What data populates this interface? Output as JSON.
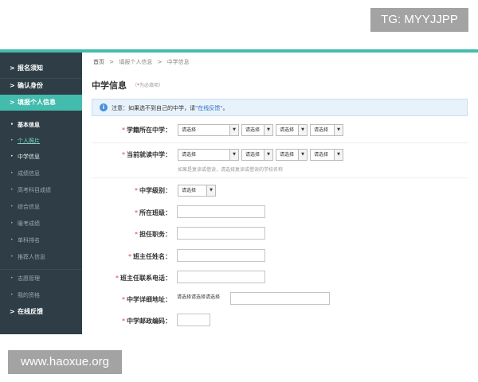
{
  "watermarks": {
    "top_right": "TG: MYYJJPP",
    "bottom_left": "www.haoxue.org"
  },
  "colors": {
    "accent": "#43bcae",
    "sidebar_bg": "#2f3e46",
    "required_star": "#e2403a",
    "link": "#2a6fc0"
  },
  "sidebar": {
    "items": [
      {
        "label": "报名须知",
        "icon": "chevron-right-icon"
      },
      {
        "label": "确认身份",
        "icon": "chevron-right-icon"
      },
      {
        "label": "填报个人信息",
        "icon": "chevron-right-icon",
        "active": true
      }
    ],
    "subitems": [
      {
        "label": "基本信息",
        "kind": "head"
      },
      {
        "label": "个人照片",
        "kind": "current"
      },
      {
        "label": "中学信息",
        "kind": "selected"
      },
      {
        "label": "成绩信息"
      },
      {
        "label": "高考科目成绩"
      },
      {
        "label": "综合信息"
      },
      {
        "label": "暖考成绩"
      },
      {
        "label": "单科排名"
      },
      {
        "label": "推荐人信息"
      }
    ],
    "lower_items": [
      {
        "label": "志愿管理"
      },
      {
        "label": "我的资格"
      }
    ],
    "bottom_item": {
      "label": "在线反馈",
      "icon": "chevron-right-icon"
    }
  },
  "breadcrumb": {
    "home": "首页",
    "sep": ">",
    "level1": "填报个人信息",
    "level2": "中学信息"
  },
  "page": {
    "title": "中学信息",
    "required_star": "*",
    "required_note": "为必填项"
  },
  "notice": {
    "icon": "info-icon",
    "text": "注意：如果选不到自己的中学，请",
    "link": "\"在线反馈\"",
    "tail": "。"
  },
  "form": {
    "star": "*",
    "school_location": {
      "label": "学籍所在中学：",
      "selects": [
        "请选择",
        "请选择",
        "请选择",
        "请选择"
      ]
    },
    "current_school": {
      "label": "当前就读中学：",
      "selects": [
        "请选择",
        "请选择",
        "请选择",
        "请选择"
      ],
      "hint": "如果是复读或借读，请选择复读或借读的学校名称"
    },
    "school_level": {
      "label": "中学级别：",
      "select": "请选择"
    },
    "class": {
      "label": "所在班级：",
      "value": ""
    },
    "position": {
      "label": "担任职务：",
      "value": ""
    },
    "teacher_name": {
      "label": "班主任姓名：",
      "value": ""
    },
    "teacher_phone": {
      "label": "班主任联系电话：",
      "value": ""
    },
    "school_address": {
      "label": "中学详细地址：",
      "value": "请选择请选择请选择"
    },
    "zip": {
      "label": "中学邮政编码：",
      "value": ""
    }
  }
}
